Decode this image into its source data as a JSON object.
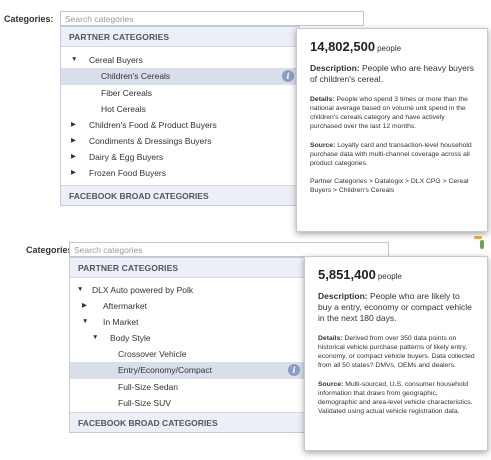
{
  "panel1": {
    "label": "Categories:",
    "search_placeholder": "Search categories",
    "header": "PARTNER CATEGORIES",
    "footer": "FACEBOOK BROAD CATEGORIES",
    "items": [
      {
        "label": "Cereal Buyers",
        "arrow": "▼"
      },
      {
        "label": "Children's Cereals",
        "arrow": ""
      },
      {
        "label": "Fiber Cereals",
        "arrow": ""
      },
      {
        "label": "Hot Cereals",
        "arrow": ""
      },
      {
        "label": "Children's Food & Product Buyers",
        "arrow": "▶"
      },
      {
        "label": "Condiments & Dressings Buyers",
        "arrow": "▶"
      },
      {
        "label": "Dairy & Egg Buyers",
        "arrow": "▶"
      },
      {
        "label": "Frozen Food Buyers",
        "arrow": "▶"
      }
    ],
    "tooltip": {
      "reach": "14,802,500",
      "unit": "people",
      "description_label": "Description:",
      "description": "People who are heavy buyers of children's cereal.",
      "details_label": "Details:",
      "details": "People who spend 3 times or more than the national average based on volume unit spend in the children's cereals category and have actively purchased over the last 12 months.",
      "source_label": "Source:",
      "source": "Loyalty card and transaction-level household purchase data with multi-channel coverage across all product categories.",
      "path": "Partner Categories > Datalogix > DLX CPG > Cereal Buyers > Children's Cereals"
    }
  },
  "panel2": {
    "label": "Categories:",
    "search_placeholder": "Search categories",
    "header": "PARTNER CATEGORIES",
    "footer": "FACEBOOK BROAD CATEGORIES",
    "items": [
      {
        "label": "DLX Auto powered by Polk",
        "arrow": "▼"
      },
      {
        "label": "Aftermarket",
        "arrow": "▶"
      },
      {
        "label": "In Market",
        "arrow": "▼"
      },
      {
        "label": "Body Style",
        "arrow": "▼"
      },
      {
        "label": "Crossover Vehicle",
        "arrow": ""
      },
      {
        "label": "Entry/Economy/Compact",
        "arrow": ""
      },
      {
        "label": "Full-Size Sedan",
        "arrow": ""
      },
      {
        "label": "Full-Size SUV",
        "arrow": ""
      }
    ],
    "tooltip": {
      "reach": "5,851,400",
      "unit": "people",
      "description_label": "Description:",
      "description": "People who are likely to buy a entry, economy or compact vehicle in the next 180 days.",
      "details_label": "Details:",
      "details": "Derived from over 350 data points on historical vehicle purchase patterns of likely entry, economy, or compact vehicle buyers. Data collected from all 50 states? DMVs, OEMs and dealers.",
      "source_label": "Source:",
      "source": "Multi-sourced, U.S. consumer household information that draws from geographic, demographic and area-level vehicle characteristics. Validated using actual vehicle registration data."
    }
  },
  "icons": {
    "info": "i",
    "info_icon_name": "info-icon"
  },
  "colors": {
    "selected_row": "#d8dfea",
    "header_bg": "#eceff5",
    "info_icon": "#8b9dc3",
    "accent_green": "#6aa84f",
    "accent_orange": "#f0a030"
  }
}
